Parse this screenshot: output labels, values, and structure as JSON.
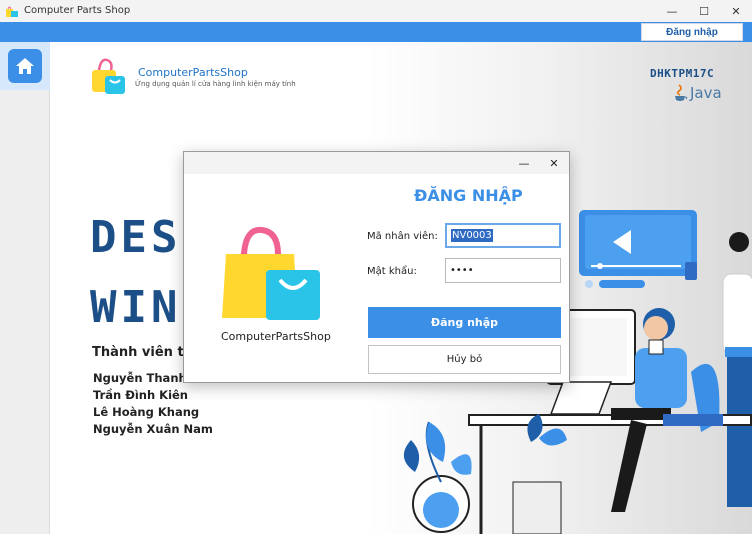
{
  "window": {
    "title": "Computer Parts Shop",
    "minimize": "—",
    "maximize": "☐",
    "close": "✕"
  },
  "topbar": {
    "login_button": "Đăng nhập"
  },
  "brand": {
    "name": "ComputerPartsShop",
    "subtitle": "Ứng dụng quản lí cửa hàng linh kiện máy tính",
    "class_code": "DHKTPM17C",
    "java": "Java"
  },
  "hero": {
    "word1": "DES",
    "word2": "WIN"
  },
  "members": {
    "title": "Thành viên th",
    "list": [
      "Nguyễn Thanh C",
      "Trần Đình Kiên",
      "Lê Hoàng Khang",
      "Nguyễn Xuân Nam"
    ]
  },
  "dialog": {
    "minimize": "—",
    "close": "✕",
    "title": "ĐĂNG NHẬP",
    "brand": "ComputerPartsShop",
    "employee_id_label": "Mã nhân viên:",
    "employee_id_value": "NV0003",
    "password_label": "Mật khẩu:",
    "password_value": "••••",
    "login_button": "Đăng nhập",
    "cancel_button": "Hủy bỏ"
  },
  "colors": {
    "accent": "#3b8fe6",
    "dark_blue": "#1c4f87",
    "bag_yellow": "#ffd72e",
    "bag_cyan": "#29c4e8",
    "bag_pink": "#f06292"
  }
}
